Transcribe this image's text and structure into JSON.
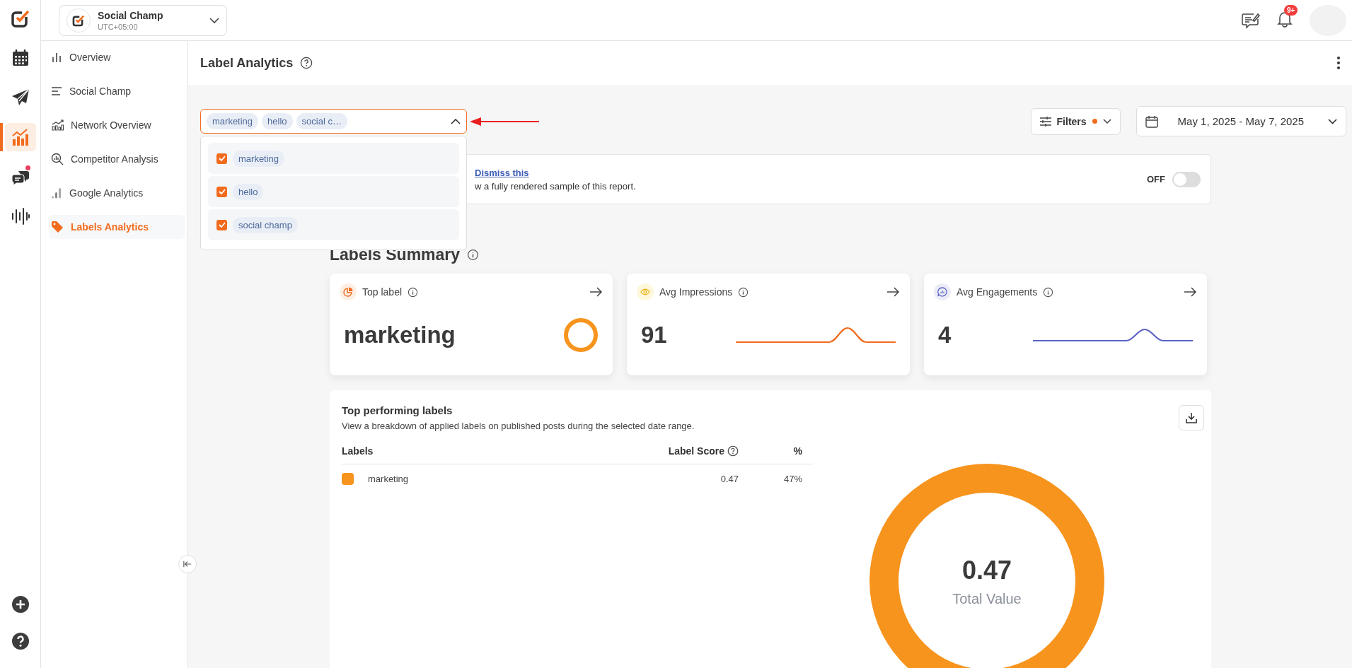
{
  "rail": {
    "items": [
      {
        "kind": "calendar",
        "selected": false,
        "unread": false
      },
      {
        "kind": "send",
        "selected": false,
        "unread": false
      },
      {
        "kind": "analytics",
        "selected": true,
        "unread": false
      },
      {
        "kind": "chat",
        "selected": false,
        "unread": true
      },
      {
        "kind": "audio",
        "selected": false,
        "unread": false
      }
    ]
  },
  "workspace": {
    "name": "Social Champ",
    "timezone": "UTC+05:00"
  },
  "notifications": {
    "badge": "9+"
  },
  "sidebar": {
    "items": [
      {
        "kind": "bars",
        "label": "Overview",
        "selected": false
      },
      {
        "kind": "lines",
        "label": "Social Champ",
        "selected": false
      },
      {
        "kind": "network",
        "label": "Network Overview",
        "selected": false
      },
      {
        "kind": "competitor",
        "label": "Competitor Analysis",
        "selected": false
      },
      {
        "kind": "google",
        "label": "Google Analytics",
        "selected": false
      },
      {
        "kind": "tag",
        "label": "Labels Analytics",
        "selected": true
      }
    ]
  },
  "page": {
    "title": "Label Analytics"
  },
  "label_select": {
    "chips": [
      "marketing",
      "hello",
      "social c…"
    ],
    "expanded": true,
    "options": [
      {
        "label": "marketing",
        "checked": true
      },
      {
        "label": "hello",
        "checked": true
      },
      {
        "label": "social champ",
        "checked": true
      }
    ]
  },
  "filters": {
    "label": "Filters",
    "active": true
  },
  "date_range": {
    "value": "May 1, 2025 - May 7, 2025"
  },
  "banner": {
    "link": "Dismiss this",
    "text": "w a fully rendered sample of this report.",
    "toggle_label": "OFF",
    "on": false
  },
  "summary": {
    "title": "Labels Summary",
    "cards": [
      {
        "kind": "ring",
        "title": "Top label",
        "value": "marketing"
      },
      {
        "kind": "impressions",
        "title": "Avg Impressions",
        "value": "91"
      },
      {
        "kind": "engagements",
        "title": "Avg Engagements",
        "value": "4"
      }
    ]
  },
  "top_labels": {
    "title": "Top performing labels",
    "description": "View a breakdown of applied labels on published posts during the selected date range.",
    "columns": [
      "Labels",
      "Label Score",
      "%"
    ],
    "rows": [
      {
        "label": "marketing",
        "color": "#f7941d",
        "score": "0.47",
        "percent": "47%"
      }
    ],
    "center_value": "0.47",
    "center_label": "Total Value"
  }
}
